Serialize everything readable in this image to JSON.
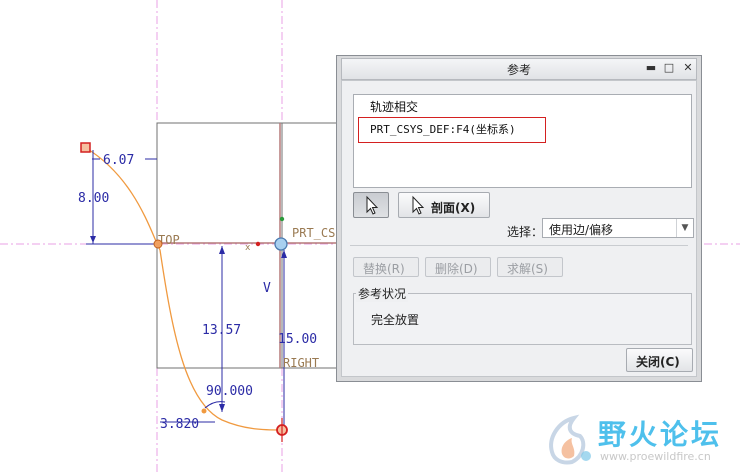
{
  "dialog": {
    "title": "参考",
    "title_buttons": {
      "minimize": "▬",
      "maximize": "□",
      "close": "✕"
    },
    "references": {
      "items": [
        "轨迹相交",
        "PRT_CSYS_DEF:F4(坐标系)"
      ]
    },
    "toolbar": {
      "arrow_icon": "arrow-cursor-icon",
      "section_label": "剖面(X)",
      "select_label": "选择：",
      "select_value": "使用边/偏移"
    },
    "actions": {
      "replace_label": "替换(R)",
      "delete_label": "删除(D)",
      "solve_label": "求解(S)"
    },
    "status": {
      "title": "参考状况",
      "text": "完全放置"
    },
    "close_label": "关闭(C)"
  },
  "sketch": {
    "dimensions": {
      "d_6_07": "6.07",
      "d_8_00": "8.00",
      "d_13_57": "13.57",
      "d_15_00": "15.00",
      "d_90": "90.000",
      "d_3_82": "3.820"
    },
    "references": {
      "top": "TOP",
      "prt_csys": "PRT_CS",
      "right": "RIGHT",
      "v": "V",
      "x": "x"
    },
    "colors": {
      "dimension": "#2b2ba6",
      "reference_plane": "#e9a0e4",
      "spline": "#f09a40",
      "constraint_red": "#d42020"
    }
  },
  "watermark": {
    "brand": "野火论坛",
    "url": "www.proewildfire.cn"
  }
}
